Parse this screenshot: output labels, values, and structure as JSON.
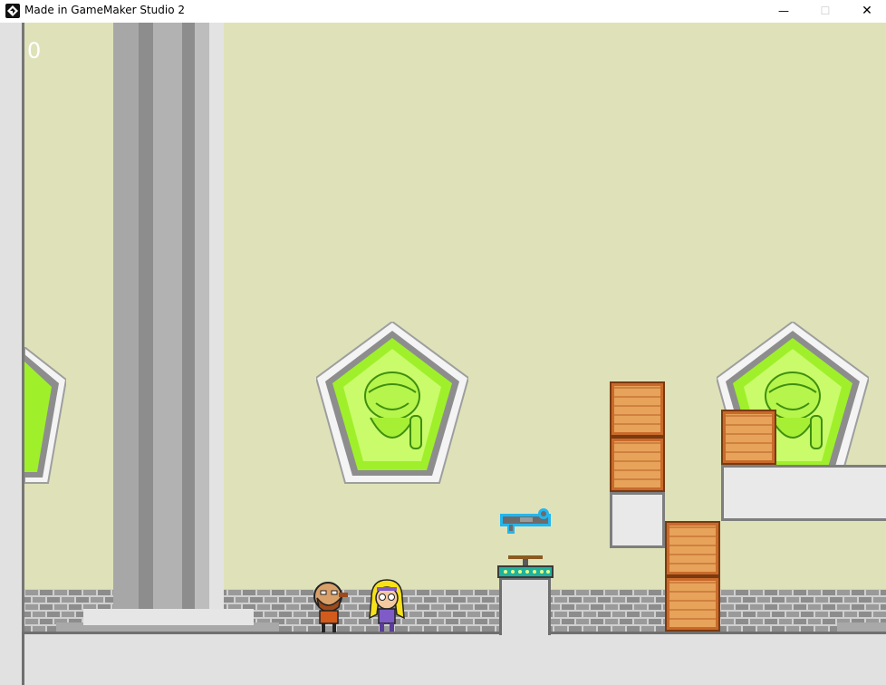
{
  "window": {
    "title": "Made in GameMaker Studio 2",
    "minimize_glyph": "—",
    "maximize_glyph": "☐",
    "close_glyph": "✕",
    "app_icon": "gamemaker-icon"
  },
  "hud": {
    "score": "0"
  },
  "colors": {
    "wall": "#dfe2b9",
    "floor": "#e1e1e1",
    "portrait_green": "#9ff02a",
    "crate": "#c96a2a",
    "gun_outline": "#22b6f0"
  },
  "sprites": {
    "player_left": "bearded-hero",
    "player_right": "blonde-elf-girl",
    "pickup": "blaster-gun",
    "springboard": "launch-pad",
    "portraits": "bearded-old-man-portrait"
  }
}
